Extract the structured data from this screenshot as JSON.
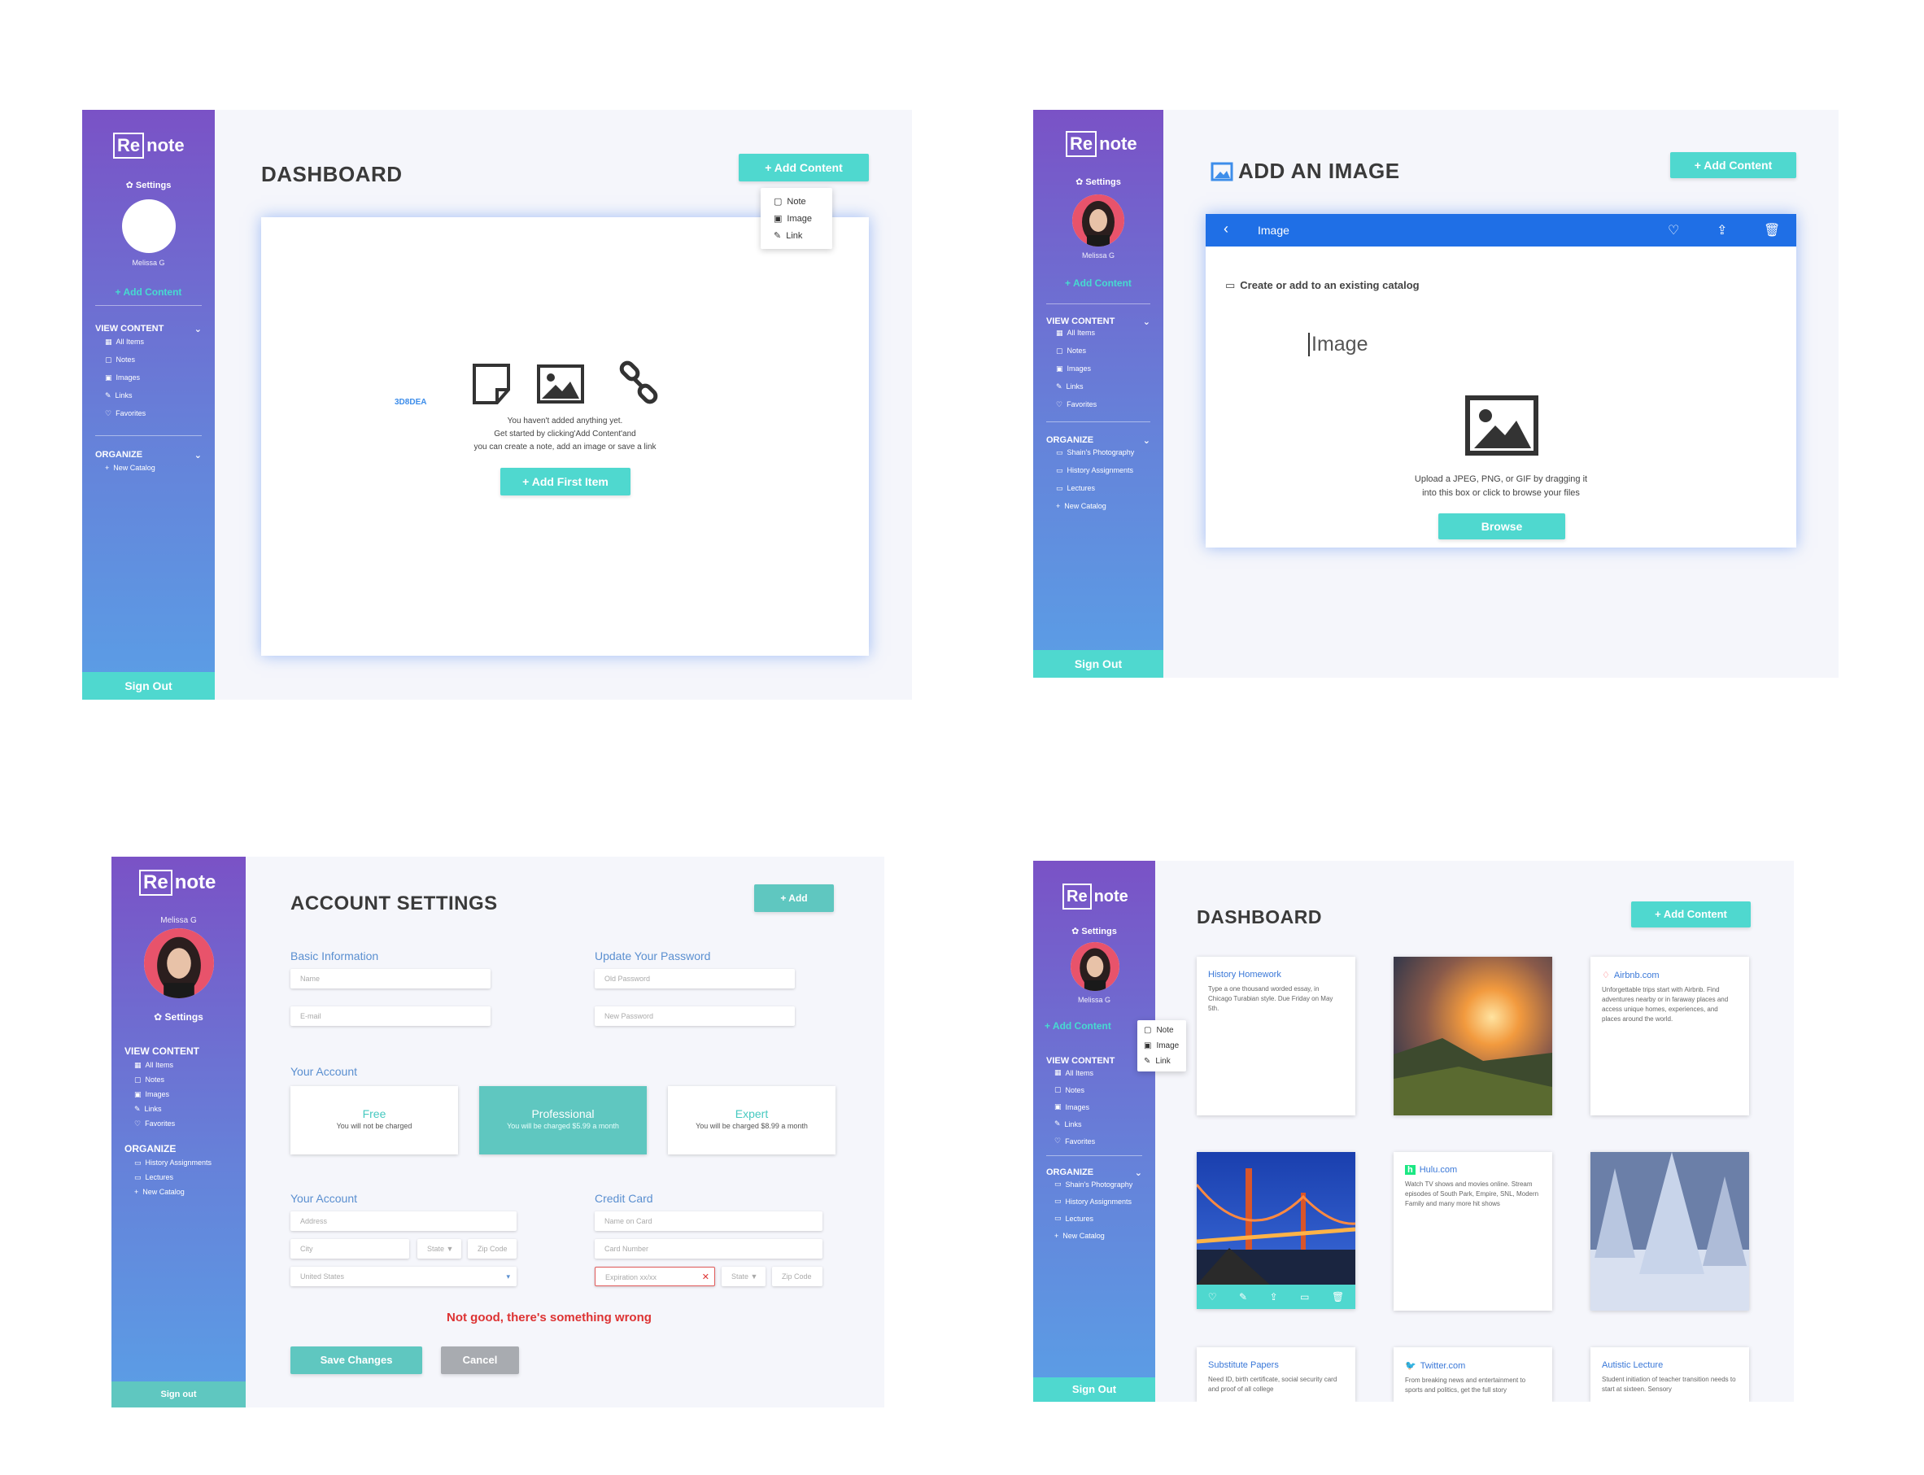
{
  "brand": {
    "logo_box": "Re",
    "logo_rest": "note"
  },
  "panel1": {
    "sidebar": {
      "settings": "✿ Settings",
      "user": "Melissa G",
      "add_content": "+ Add Content",
      "view_heading": "VIEW CONTENT",
      "view_items": [
        "All Items",
        "Notes",
        "Images",
        "Links",
        "Favorites"
      ],
      "organize_heading": "ORGANIZE",
      "organize_items": [
        "New Catalog"
      ],
      "signout": "Sign Out"
    },
    "title": "DASHBOARD",
    "add_button": "+ Add Content",
    "menu": [
      "Note",
      "Image",
      "Link"
    ],
    "color_code": "3D8DEA",
    "empty_lines": [
      "You haven't added anything yet.",
      "Get started by clicking'Add Content'and",
      "you can create a note, add an image or save a link"
    ],
    "first_button": "+ Add First Item"
  },
  "panel2": {
    "sidebar": {
      "settings": "✿ Settings",
      "user": "Melissa G",
      "add_content": "+ Add Content",
      "view_heading": "VIEW CONTENT",
      "view_items": [
        "All Items",
        "Notes",
        "Images",
        "Links",
        "Favorites"
      ],
      "organize_heading": "ORGANIZE",
      "organize_items": [
        "Shain's Photography",
        "History Assignments",
        "Lectures",
        "New Catalog"
      ],
      "signout": "Sign Out"
    },
    "title": "ADD AN IMAGE",
    "add_button": "+ Add Content",
    "bar_title": "Image",
    "catalog": "Create or add to an existing catalog",
    "image_input": "Image",
    "upload_lines": [
      "Upload a JPEG, PNG, or GIF by dragging it",
      "into this box or click to browse your files"
    ],
    "browse": "Browse"
  },
  "panel3": {
    "sidebar": {
      "user": "Melissa G",
      "settings": "✿ Settings",
      "view_heading": "VIEW CONTENT",
      "view_items": [
        "All Items",
        "Notes",
        "Images",
        "Links",
        "Favorites"
      ],
      "organize_heading": "ORGANIZE",
      "organize_items": [
        "History Assignments",
        "Lectures",
        "New Catalog"
      ],
      "signout": "Sign out"
    },
    "title": "ACCOUNT SETTINGS",
    "add_button": "+ Add",
    "basic_info": "Basic Information",
    "name_ph": "Name",
    "email_ph": "E-mail",
    "update_pw": "Update Your Password",
    "old_pw_ph": "Old Password",
    "new_pw_ph": "New Password",
    "your_account": "Your Account",
    "plans": [
      {
        "name": "Free",
        "desc": "You will not be charged"
      },
      {
        "name": "Professional",
        "desc": "You will be charged $5.99 a month"
      },
      {
        "name": "Expert",
        "desc": "You will be charged $8.99 a month"
      }
    ],
    "your_account2": "Your Account",
    "address_ph": "Address",
    "city_ph": "City",
    "state_ph": "State ▼",
    "zip_ph": "Zip Code",
    "country": "United States",
    "credit_card": "Credit Card",
    "name_card_ph": "Name on Card",
    "card_num_ph": "Card Number",
    "exp_ph": "Expiration xx/xx",
    "state2_ph": "State ▼",
    "zip2_ph": "Zip Code",
    "error": "Not good, there's something wrong",
    "save": "Save Changes",
    "cancel": "Cancel"
  },
  "panel4": {
    "sidebar": {
      "settings": "✿ Settings",
      "user": "Melissa G",
      "add_content": "+ Add Content",
      "view_heading": "VIEW CONTENT",
      "view_items": [
        "All Items",
        "Notes",
        "Images",
        "Links",
        "Favorites"
      ],
      "organize_heading": "ORGANIZE",
      "organize_items": [
        "Shain's Photography",
        "History Assignments",
        "Lectures",
        "New Catalog"
      ],
      "signout": "Sign Out"
    },
    "menu": [
      "Note",
      "Image",
      "Link"
    ],
    "title": "DASHBOARD",
    "add_button": "+ Add Content",
    "tiles": {
      "history_title": "History Homework",
      "history_body": "Type a one thousand worded essay, in Chicago Turabian style. Due Friday on May 5th.",
      "airbnb_title": "Airbnb.com",
      "airbnb_body": "Unforgettable trips start with Airbnb. Find adventures nearby or in faraway places and access unique homes, experiences, and places around the world.",
      "hulu_title": "Hulu.com",
      "hulu_body": "Watch TV shows and movies online. Stream episodes of South Park, Empire, SNL, Modern Family and many more hit shows",
      "sub_title": "Substitute Papers",
      "sub_body": "Need ID, birth certificate, social security card and proof of all college",
      "twitter_title": "Twitter.com",
      "twitter_body": "From breaking news and entertainment to sports and politics, get the full story",
      "autistic_title": "Autistic Lecture",
      "autistic_body": "Student initiation of teacher transition needs to start at sixteen. Sensory"
    }
  }
}
